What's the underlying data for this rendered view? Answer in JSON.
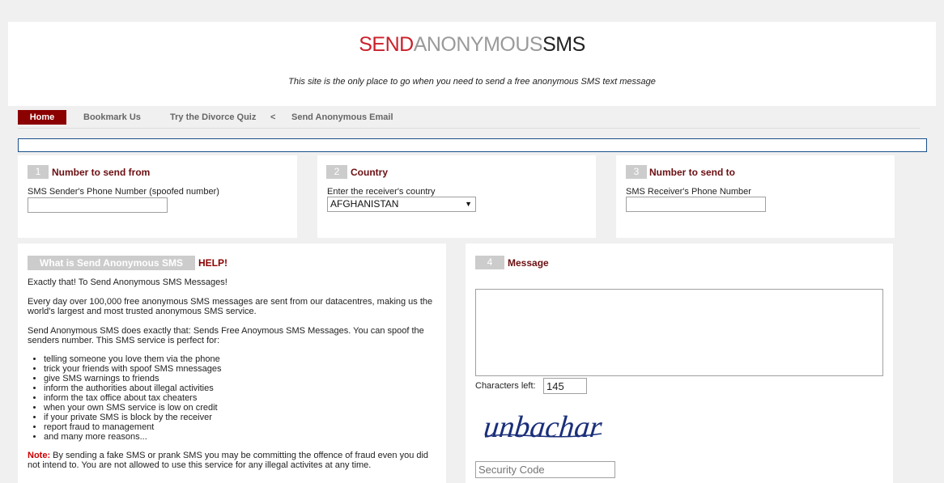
{
  "header": {
    "logo_part1": "SEND",
    "logo_part2": "ANONYMOUS",
    "logo_part3": "SMS",
    "tagline": "This site is the only place to go when you need to send a free anonymous SMS text message"
  },
  "nav": {
    "items": [
      {
        "label": "Home"
      },
      {
        "label": "Bookmark Us"
      },
      {
        "label": "Try the Divorce Quiz"
      },
      {
        "label": "<"
      },
      {
        "label": "Send Anonymous Email"
      }
    ]
  },
  "step1": {
    "number": "1",
    "title": "Number to send from",
    "field_label": "SMS Sender's Phone Number (spoofed number)",
    "value": ""
  },
  "step2": {
    "number": "2",
    "title": "Country",
    "field_label": "Enter the receiver's country",
    "selected": "AFGHANISTAN"
  },
  "step3": {
    "number": "3",
    "title": "Number to send to",
    "field_label": "SMS Receiver's Phone Number",
    "value": ""
  },
  "info": {
    "button_label": "What is Send Anonymous SMS",
    "help": "HELP!",
    "p1": "Exactly that! To Send Anonymous SMS Messages!",
    "p2": "Every day over 100,000 free anonymous SMS messages are sent from our datacentres, making us the world's largest and most trusted anonymous SMS service.",
    "p3": "Send Anonymous SMS does exactly that: Sends Free Anoymous SMS Messages. You can spoof the senders number. This SMS service is perfect for:",
    "list": [
      "telling someone you love them via the phone",
      "trick your friends with spoof SMS mnessages",
      "give SMS warnings to friends",
      "inform the authorities about illegal activities",
      "inform the tax office about tax cheaters",
      "when your own SMS service is low on credit",
      "if your private SMS is block by the receiver",
      "report fraud to management",
      "and many more reasons..."
    ],
    "note_label": "Note:",
    "note_text": " By sending a fake SMS or prank SMS you may be committing the offence of fraud even you did not intend to. You are not allowed to use this service for any illegal activites at any time."
  },
  "step4": {
    "number": "4",
    "title": "Message",
    "message_value": "",
    "chars_label": "Characters left:",
    "chars_value": "145",
    "captcha_text": "unbachar",
    "security_placeholder": "Security Code"
  }
}
